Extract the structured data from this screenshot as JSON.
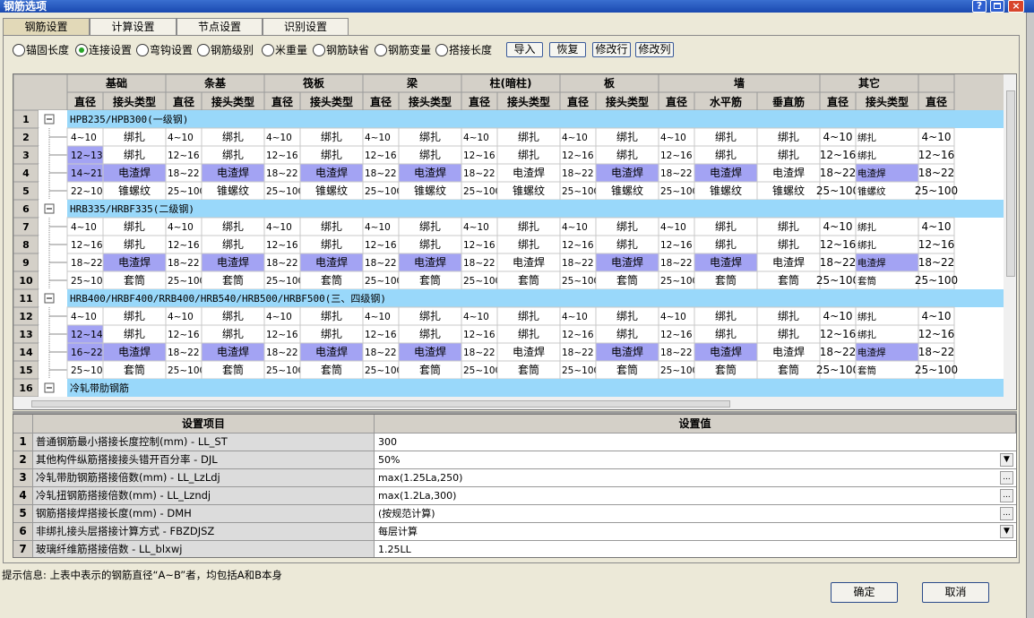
{
  "window": {
    "title": "钢筋选项",
    "help_label": "?",
    "close_label": "×"
  },
  "tabs": [
    "钢筋设置",
    "计算设置",
    "节点设置",
    "识别设置"
  ],
  "options": {
    "radios": [
      "锚固长度",
      "连接设置",
      "弯钩设置",
      "钢筋级别",
      "米重量",
      "钢筋缺省",
      "钢筋变量",
      "搭接长度"
    ],
    "selected": "连接设置",
    "buttons": [
      "导入",
      "恢复",
      "修改行",
      "修改列"
    ]
  },
  "grid": {
    "groups": [
      "基础",
      "条基",
      "筏板",
      "梁",
      "柱(暗柱)",
      "板",
      "墙",
      "其它"
    ],
    "subheaders": [
      "直径",
      "接头类型",
      "直径",
      "接头类型",
      "直径",
      "接头类型",
      "直径",
      "接头类型",
      "直径",
      "接头类型",
      "直径",
      "接头类型",
      "直径",
      "水平筋",
      "垂直筋",
      "直径",
      "接头类型",
      "直径"
    ],
    "rows": [
      {
        "num": "1",
        "header": true,
        "text": "HPB235/HPB300(一级钢)"
      },
      {
        "num": "2",
        "cells": [
          "4~10",
          "绑扎",
          "4~10",
          "绑扎",
          "4~10",
          "绑扎",
          "4~10",
          "绑扎",
          "4~10",
          "绑扎",
          "4~10",
          "绑扎",
          "4~10",
          "绑扎",
          "绑扎",
          "4~10",
          "绑扎",
          "4~10"
        ],
        "hl": []
      },
      {
        "num": "3",
        "cells": [
          "12~13",
          "绑扎",
          "12~16",
          "绑扎",
          "12~16",
          "绑扎",
          "12~16",
          "绑扎",
          "12~16",
          "绑扎",
          "12~16",
          "绑扎",
          "12~16",
          "绑扎",
          "绑扎",
          "12~16",
          "绑扎",
          "12~16"
        ],
        "hl": [
          0
        ]
      },
      {
        "num": "4",
        "cells": [
          "14~21",
          "电渣焊",
          "18~22",
          "电渣焊",
          "18~22",
          "电渣焊",
          "18~22",
          "电渣焊",
          "18~22",
          "电渣焊",
          "18~22",
          "电渣焊",
          "18~22",
          "电渣焊",
          "电渣焊",
          "18~22",
          "电渣焊",
          "18~22"
        ],
        "hl": [
          0,
          1,
          3,
          5,
          7,
          11,
          13,
          16
        ]
      },
      {
        "num": "5",
        "cells": [
          "22~100",
          "锥螺纹",
          "25~100",
          "锥螺纹",
          "25~100",
          "锥螺纹",
          "25~100",
          "锥螺纹",
          "25~100",
          "锥螺纹",
          "25~100",
          "锥螺纹",
          "25~100",
          "锥螺纹",
          "锥螺纹",
          "25~100",
          "锥螺纹",
          "25~100"
        ],
        "hl": []
      },
      {
        "num": "6",
        "header": true,
        "text": "HRB335/HRBF335(二级钢)"
      },
      {
        "num": "7",
        "cells": [
          "4~10",
          "绑扎",
          "4~10",
          "绑扎",
          "4~10",
          "绑扎",
          "4~10",
          "绑扎",
          "4~10",
          "绑扎",
          "4~10",
          "绑扎",
          "4~10",
          "绑扎",
          "绑扎",
          "4~10",
          "绑扎",
          "4~10"
        ],
        "hl": []
      },
      {
        "num": "8",
        "cells": [
          "12~16",
          "绑扎",
          "12~16",
          "绑扎",
          "12~16",
          "绑扎",
          "12~16",
          "绑扎",
          "12~16",
          "绑扎",
          "12~16",
          "绑扎",
          "12~16",
          "绑扎",
          "绑扎",
          "12~16",
          "绑扎",
          "12~16"
        ],
        "hl": []
      },
      {
        "num": "9",
        "cells": [
          "18~22",
          "电渣焊",
          "18~22",
          "电渣焊",
          "18~22",
          "电渣焊",
          "18~22",
          "电渣焊",
          "18~22",
          "电渣焊",
          "18~22",
          "电渣焊",
          "18~22",
          "电渣焊",
          "电渣焊",
          "18~22",
          "电渣焊",
          "18~22"
        ],
        "hl": [
          1,
          3,
          5,
          7,
          11,
          13,
          16
        ]
      },
      {
        "num": "10",
        "cells": [
          "25~100",
          "套筒",
          "25~100",
          "套筒",
          "25~100",
          "套筒",
          "25~100",
          "套筒",
          "25~100",
          "套筒",
          "25~100",
          "套筒",
          "25~100",
          "套筒",
          "套筒",
          "25~100",
          "套筒",
          "25~100"
        ],
        "hl": []
      },
      {
        "num": "11",
        "header": true,
        "text": "HRB400/HRBF400/RRB400/HRB540/HRB500/HRBF500(三、四级钢)"
      },
      {
        "num": "12",
        "cells": [
          "4~10",
          "绑扎",
          "4~10",
          "绑扎",
          "4~10",
          "绑扎",
          "4~10",
          "绑扎",
          "4~10",
          "绑扎",
          "4~10",
          "绑扎",
          "4~10",
          "绑扎",
          "绑扎",
          "4~10",
          "绑扎",
          "4~10"
        ],
        "hl": []
      },
      {
        "num": "13",
        "cells": [
          "12~14",
          "绑扎",
          "12~16",
          "绑扎",
          "12~16",
          "绑扎",
          "12~16",
          "绑扎",
          "12~16",
          "绑扎",
          "12~16",
          "绑扎",
          "12~16",
          "绑扎",
          "绑扎",
          "12~16",
          "绑扎",
          "12~16"
        ],
        "hl": [
          0
        ]
      },
      {
        "num": "14",
        "cells": [
          "16~22",
          "电渣焊",
          "18~22",
          "电渣焊",
          "18~22",
          "电渣焊",
          "18~22",
          "电渣焊",
          "18~22",
          "电渣焊",
          "18~22",
          "电渣焊",
          "18~22",
          "电渣焊",
          "电渣焊",
          "18~22",
          "电渣焊",
          "18~22"
        ],
        "hl": [
          0,
          1,
          3,
          5,
          7,
          11,
          13,
          16
        ]
      },
      {
        "num": "15",
        "cells": [
          "25~100",
          "套筒",
          "25~100",
          "套筒",
          "25~100",
          "套筒",
          "25~100",
          "套筒",
          "25~100",
          "套筒",
          "25~100",
          "套筒",
          "25~100",
          "套筒",
          "套筒",
          "25~100",
          "套筒",
          "25~100"
        ],
        "hl": []
      },
      {
        "num": "16",
        "header": true,
        "text": "冷轧带肋钢筋"
      }
    ],
    "colors": {
      "group_row": "#99d8fa",
      "highlight": "#a3a3f3",
      "header_bg": "#d4d0c8",
      "number_bg": "#d4d0c8"
    }
  },
  "settings": {
    "col_item": "设置项目",
    "col_value": "设置值",
    "rows": [
      {
        "num": "1",
        "name": "普通钢筋最小搭接长度控制(mm) - LL_ST",
        "value": "300",
        "control": ""
      },
      {
        "num": "2",
        "name": "其他构件纵筋搭接接头错开百分率 - DJL",
        "value": "50%",
        "control": "dropdown"
      },
      {
        "num": "3",
        "name": "冷轧带肋钢筋搭接倍数(mm) - LL_LzLdj",
        "value": "max(1.25La,250)",
        "control": "ellipsis"
      },
      {
        "num": "4",
        "name": "冷轧扭钢筋搭接倍数(mm) - LL_Lzndj",
        "value": "max(1.2La,300)",
        "control": "ellipsis"
      },
      {
        "num": "5",
        "name": "钢筋搭接焊搭接长度(mm) - DMH",
        "value": "(按规范计算)",
        "control": "ellipsis"
      },
      {
        "num": "6",
        "name": "非绑扎接头层搭接计算方式 - FBZDJSZ",
        "value": "每层计算",
        "control": "dropdown"
      },
      {
        "num": "7",
        "name": "玻璃纤维筋搭接倍数 - LL_blxwj",
        "value": "1.25LL",
        "control": ""
      }
    ]
  },
  "hint": "提示信息: 上表中表示的钢筋直径“A~B”者，均包括A和B本身",
  "dialog_buttons": {
    "ok": "确定",
    "cancel": "取消"
  }
}
